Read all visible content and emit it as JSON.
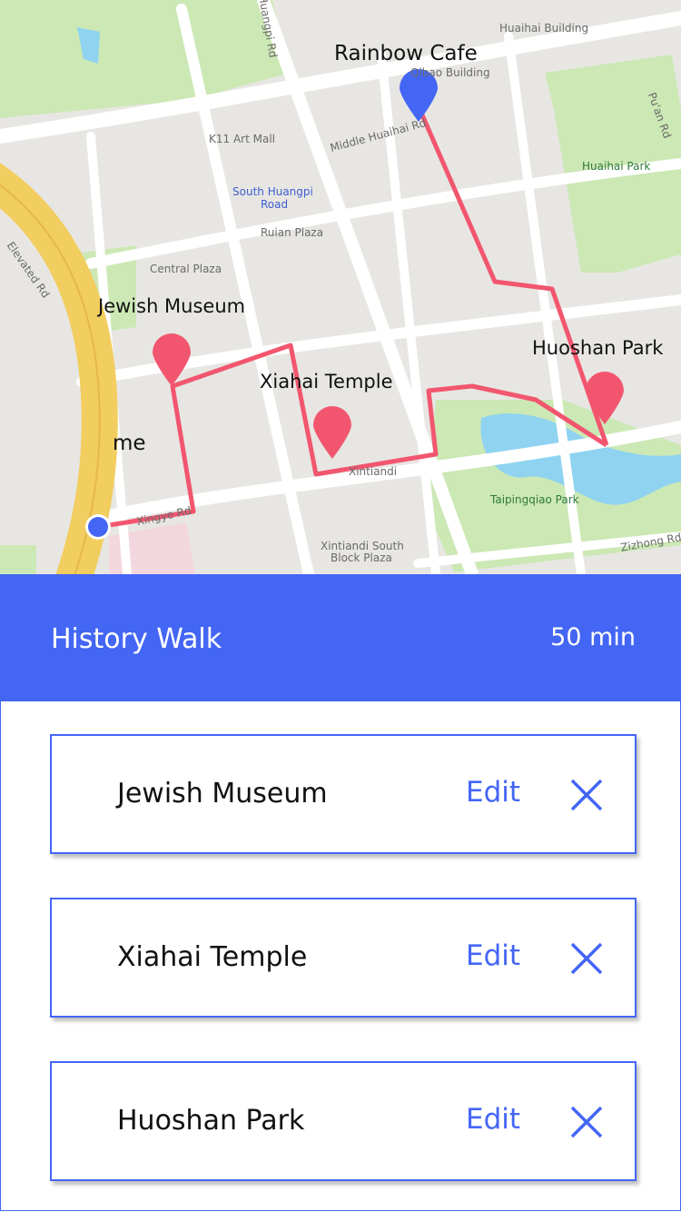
{
  "map": {
    "labels": {
      "rainbow_cafe": "Rainbow Cafe",
      "jewish_museum": "Jewish Museum",
      "xiahai_temple": "Xiahai Temple",
      "huoshan_park": "Huoshan Park",
      "me": "me"
    },
    "places": {
      "huangpi_rd": "Huangpi Rd",
      "huaihai_building": "Huaihai Building",
      "qibao_building": "Qibao Building",
      "puan_rd": "Pu'an Rd",
      "k11": "K11 Art Mall",
      "middle_huaihai": "Middle Huaihai Rd",
      "huaihai_park": "Huaihai Park",
      "south_huangpi": "South Huangpi",
      "south_huangpi_2": "Road",
      "ruian_plaza": "Ruian Plaza",
      "central_plaza": "Central Plaza",
      "elevated_rd": "Elevated Rd",
      "xintiandi": "Xintiandi",
      "taipingqiao_park": "Taipingqiao Park",
      "xintiandi_south": "Xintiandi South",
      "block_plaza": "Block Plaza",
      "zizhong_rd": "Zizhong Rd",
      "xingye_rd": "Xingye Rd",
      "zizhong_rd_left": "Zizhong Rd"
    },
    "colors": {
      "route": "#f2566f",
      "pin": "#f2566f",
      "start_pin": "#4466f5",
      "me_dot": "#4466f5",
      "park": "#cce8b5",
      "water": "#8fd3f0",
      "road": "#ffffff",
      "highway": "#f2cd5f"
    }
  },
  "header": {
    "title": "History Walk",
    "duration": "50 min"
  },
  "stops": [
    {
      "name": "Jewish Museum",
      "edit_label": "Edit",
      "remove_icon": "close-icon"
    },
    {
      "name": "Xiahai Temple",
      "edit_label": "Edit",
      "remove_icon": "close-icon"
    },
    {
      "name": "Huoshan Park",
      "edit_label": "Edit",
      "remove_icon": "close-icon"
    }
  ]
}
